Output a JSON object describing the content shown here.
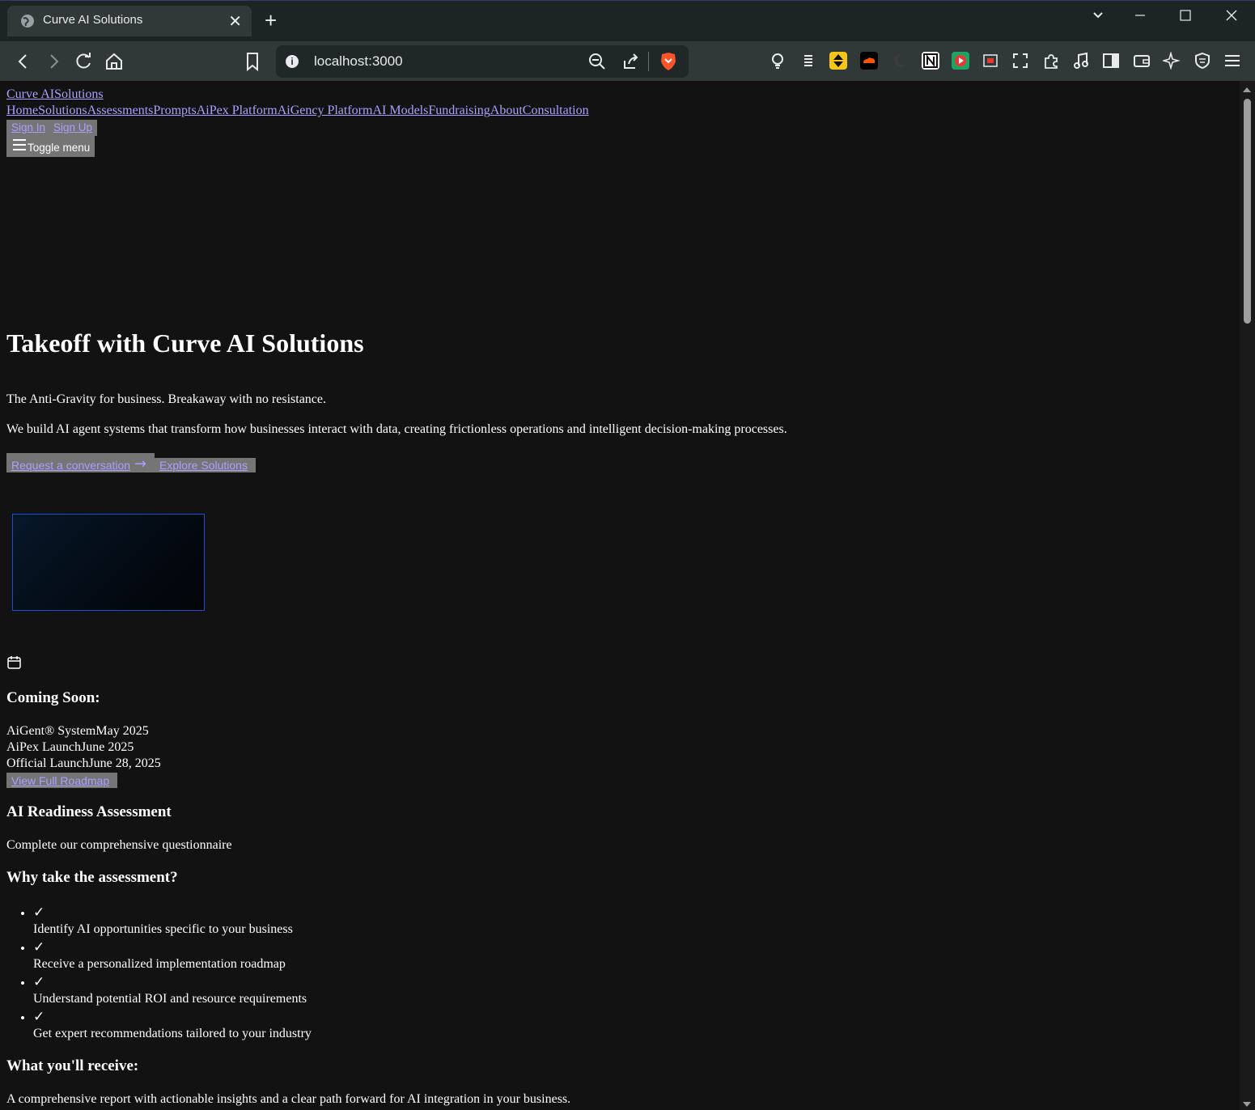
{
  "browser": {
    "tab_title": "Curve AI Solutions",
    "tab_close": "✕",
    "new_tab": "+",
    "url": "localhost:3000",
    "icons": [
      "back-icon",
      "forward-icon",
      "reload-icon",
      "home-icon",
      "bookmark-icon",
      "site-info-icon",
      "zoom-icon",
      "share-icon",
      "brave-shield-icon",
      "extensions-icon",
      "media-icon",
      "sidebar-icon",
      "wallet-icon",
      "leo-ai-icon",
      "vpn-icon",
      "menu-icon"
    ]
  },
  "header": {
    "logo_part1": "Curve AI",
    "logo_part2": "Solutions",
    "nav": [
      "Home",
      "Solutions",
      "Assessments",
      "Prompts",
      "AiPex Platform",
      "AiGency Platform",
      "AI Models",
      "Fundraising",
      "About",
      "Consultation"
    ],
    "sign_in": "Sign In",
    "sign_up": "Sign Up",
    "toggle_menu": "Toggle menu"
  },
  "hero": {
    "title": "Takeoff with Curve AI Solutions",
    "tagline": "The Anti-Gravity for business. Breakaway with no resistance.",
    "description": "We build AI agent systems that transform how businesses interact with data, creating frictionless operations and intelligent decision-making processes.",
    "cta_primary": "Request a conversation",
    "cta_secondary": "Explore Solutions"
  },
  "coming_soon": {
    "heading": "Coming Soon:",
    "items": [
      {
        "name": "AiGent® System",
        "date": "May 2025"
      },
      {
        "name": "AiPex Launch",
        "date": "June 2025"
      },
      {
        "name": "Official Launch",
        "date": "June 28, 2025"
      }
    ],
    "roadmap_button": "View Full Roadmap"
  },
  "assessment": {
    "heading": "AI Readiness Assessment",
    "subtitle": "Complete our comprehensive questionnaire",
    "why_heading": "Why take the assessment?",
    "check": "✓",
    "benefits": [
      "Identify AI opportunities specific to your business",
      "Receive a personalized implementation roadmap",
      "Understand potential ROI and resource requirements",
      "Get expert recommendations tailored to your industry"
    ],
    "receive_heading": "What you'll receive:",
    "receive_text": "A comprehensive report with actionable insights and a clear path forward for AI integration in your business."
  },
  "colors": {
    "page_bg": "#121212",
    "link": "#aaa0ff",
    "button_bg": "#757575",
    "preview_border": "#1d4ed8",
    "chrome_bg": "#303838"
  }
}
